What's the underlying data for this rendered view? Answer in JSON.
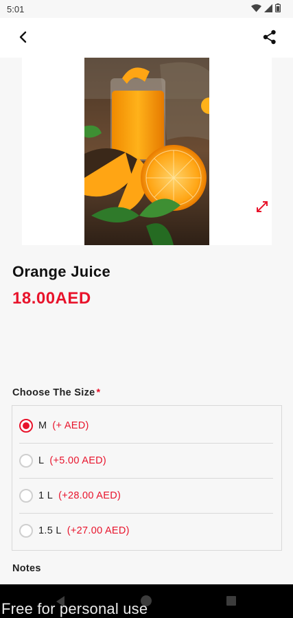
{
  "status_bar": {
    "time": "5:01",
    "icons": [
      "wifi-icon",
      "signal-icon",
      "battery-icon"
    ]
  },
  "app_bar": {
    "back_icon": "chevron-left-icon",
    "share_icon": "share-icon"
  },
  "product": {
    "name": "Orange Juice",
    "price": "18.00AED",
    "image_alt": "Orange juice photo",
    "expand_icon": "expand-icon"
  },
  "size_section": {
    "heading": "Choose The Size",
    "required_mark": "*",
    "selected_index": 0,
    "options": [
      {
        "label": "M",
        "price": "(+ AED)",
        "selected": true
      },
      {
        "label": "L",
        "price": "(+5.00 AED)",
        "selected": false
      },
      {
        "label": "1 L",
        "price": "(+28.00 AED)",
        "selected": false
      },
      {
        "label": "1.5 L",
        "price": "(+27.00 AED)",
        "selected": false
      }
    ]
  },
  "notes_section": {
    "heading": "Notes"
  },
  "nav_bar": {
    "icons": [
      "nav-back-icon",
      "nav-home-icon",
      "nav-recents-icon"
    ]
  },
  "watermark": "Free for personal use",
  "colors": {
    "accent": "#e8132b",
    "background": "#f7f7f7",
    "surface": "#ffffff",
    "text": "#111111",
    "nav_bar": "#000000"
  }
}
